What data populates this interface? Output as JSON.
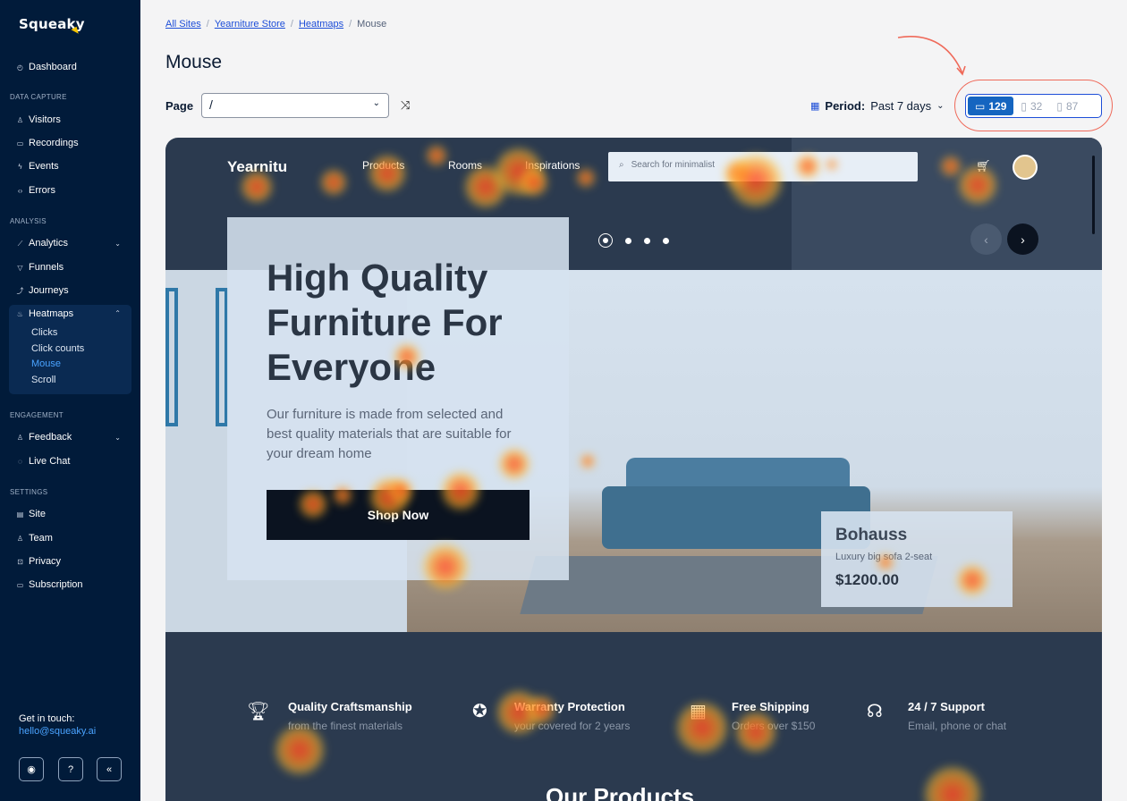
{
  "app": {
    "name": "Squeaky"
  },
  "sidebar": {
    "dashboard": "Dashboard",
    "sections": {
      "data_capture": "DATA CAPTURE",
      "analysis": "ANALYSIS",
      "engagement": "ENGAGEMENT",
      "settings": "SETTINGS"
    },
    "items": {
      "visitors": "Visitors",
      "recordings": "Recordings",
      "events": "Events",
      "errors": "Errors",
      "analytics": "Analytics",
      "funnels": "Funnels",
      "journeys": "Journeys",
      "heatmaps": "Heatmaps",
      "feedback": "Feedback",
      "live_chat": "Live Chat",
      "site": "Site",
      "team": "Team",
      "privacy": "Privacy",
      "subscription": "Subscription"
    },
    "heatmap_subitems": [
      "Clicks",
      "Click counts",
      "Mouse",
      "Scroll"
    ],
    "active_subitem": "Mouse",
    "get_in_touch": "Get in touch:",
    "email": "hello@squeaky.ai"
  },
  "breadcrumbs": [
    "All Sites",
    "Yearniture Store",
    "Heatmaps",
    "Mouse"
  ],
  "page_title": "Mouse",
  "page_filter": {
    "label": "Page",
    "value": "/"
  },
  "period": {
    "label": "Period:",
    "value": "Past 7 days"
  },
  "devices": [
    {
      "name": "desktop",
      "count": "129",
      "active": true
    },
    {
      "name": "tablet",
      "count": "32",
      "active": false
    },
    {
      "name": "mobile",
      "count": "87",
      "active": false
    }
  ],
  "colors": {
    "sidebar": "#011b3a",
    "accent": "#1565c0",
    "highlight": "#ef6a5a"
  },
  "preview": {
    "logo": "Yearnitu",
    "nav": [
      "Products",
      "Rooms",
      "Inspirations"
    ],
    "search_placeholder": "Search for minimalist",
    "hero_title": "High Quality Furniture For Everyone",
    "hero_subtitle": "Our furniture is made from selected and best quality materials that are suitable for your dream home",
    "cta": "Shop Now",
    "product": {
      "name": "Bohauss",
      "desc": "Luxury big sofa 2-seat",
      "price": "$1200.00"
    },
    "features": [
      {
        "title": "Quality Craftsmanship",
        "sub": "from the finest materials"
      },
      {
        "title": "Warranty Protection",
        "sub": "your covered for 2 years"
      },
      {
        "title": "Free Shipping",
        "sub": "Orders over $150"
      },
      {
        "title": "24 / 7 Support",
        "sub": "Email, phone or chat"
      }
    ],
    "section_title": "Our Products"
  }
}
